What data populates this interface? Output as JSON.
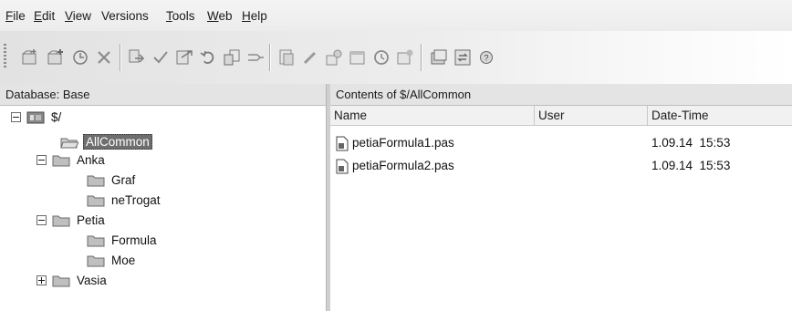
{
  "menu": [
    {
      "label": "File",
      "accel": "F",
      "rest": "ile"
    },
    {
      "label": "Edit",
      "accel": "E",
      "rest": "dit"
    },
    {
      "label": "View",
      "accel": "V",
      "rest": "iew"
    },
    {
      "label": "Versions",
      "accel": "",
      "rest": "Versions"
    },
    {
      "label": "Tools",
      "accel": "T",
      "rest": "ools"
    },
    {
      "label": "Web",
      "accel": "W",
      "rest": "eb"
    },
    {
      "label": "Help",
      "accel": "H",
      "rest": "elp"
    }
  ],
  "toolbar_icons": [
    "new-project-icon",
    "add-file-icon",
    "history-icon",
    "delete-icon",
    "get-latest-icon",
    "check-out-icon",
    "check-in-icon",
    "undo-checkout-icon",
    "label-icon",
    "share-icon",
    "view-file-icon",
    "edit-file-icon",
    "properties-icon",
    "options-icon",
    "refresh-icon",
    "web-icon",
    "explorer-icon",
    "show-differences-icon",
    "help-icon"
  ],
  "left_header": "Database: Base",
  "right_header": "Contents of $/AllCommon",
  "tree": {
    "root": "$/",
    "nodes": [
      {
        "label": "AllCommon",
        "selected": true
      },
      {
        "label": "Anka"
      },
      {
        "label": "Graf"
      },
      {
        "label": "neTrogat"
      },
      {
        "label": "Petia"
      },
      {
        "label": "Formula"
      },
      {
        "label": "Moe"
      },
      {
        "label": "Vasia"
      }
    ]
  },
  "columns": [
    "Name",
    "User",
    "Date-Time"
  ],
  "files": [
    {
      "name": "petiaFormula1.pas",
      "user": "",
      "datetime": "1.09.14  15:53"
    },
    {
      "name": "petiaFormula2.pas",
      "user": "",
      "datetime": "1.09.14  15:53"
    }
  ],
  "colors": {
    "selected_bg": "#6e6e6e",
    "header_bg": "#e4e4e4"
  }
}
